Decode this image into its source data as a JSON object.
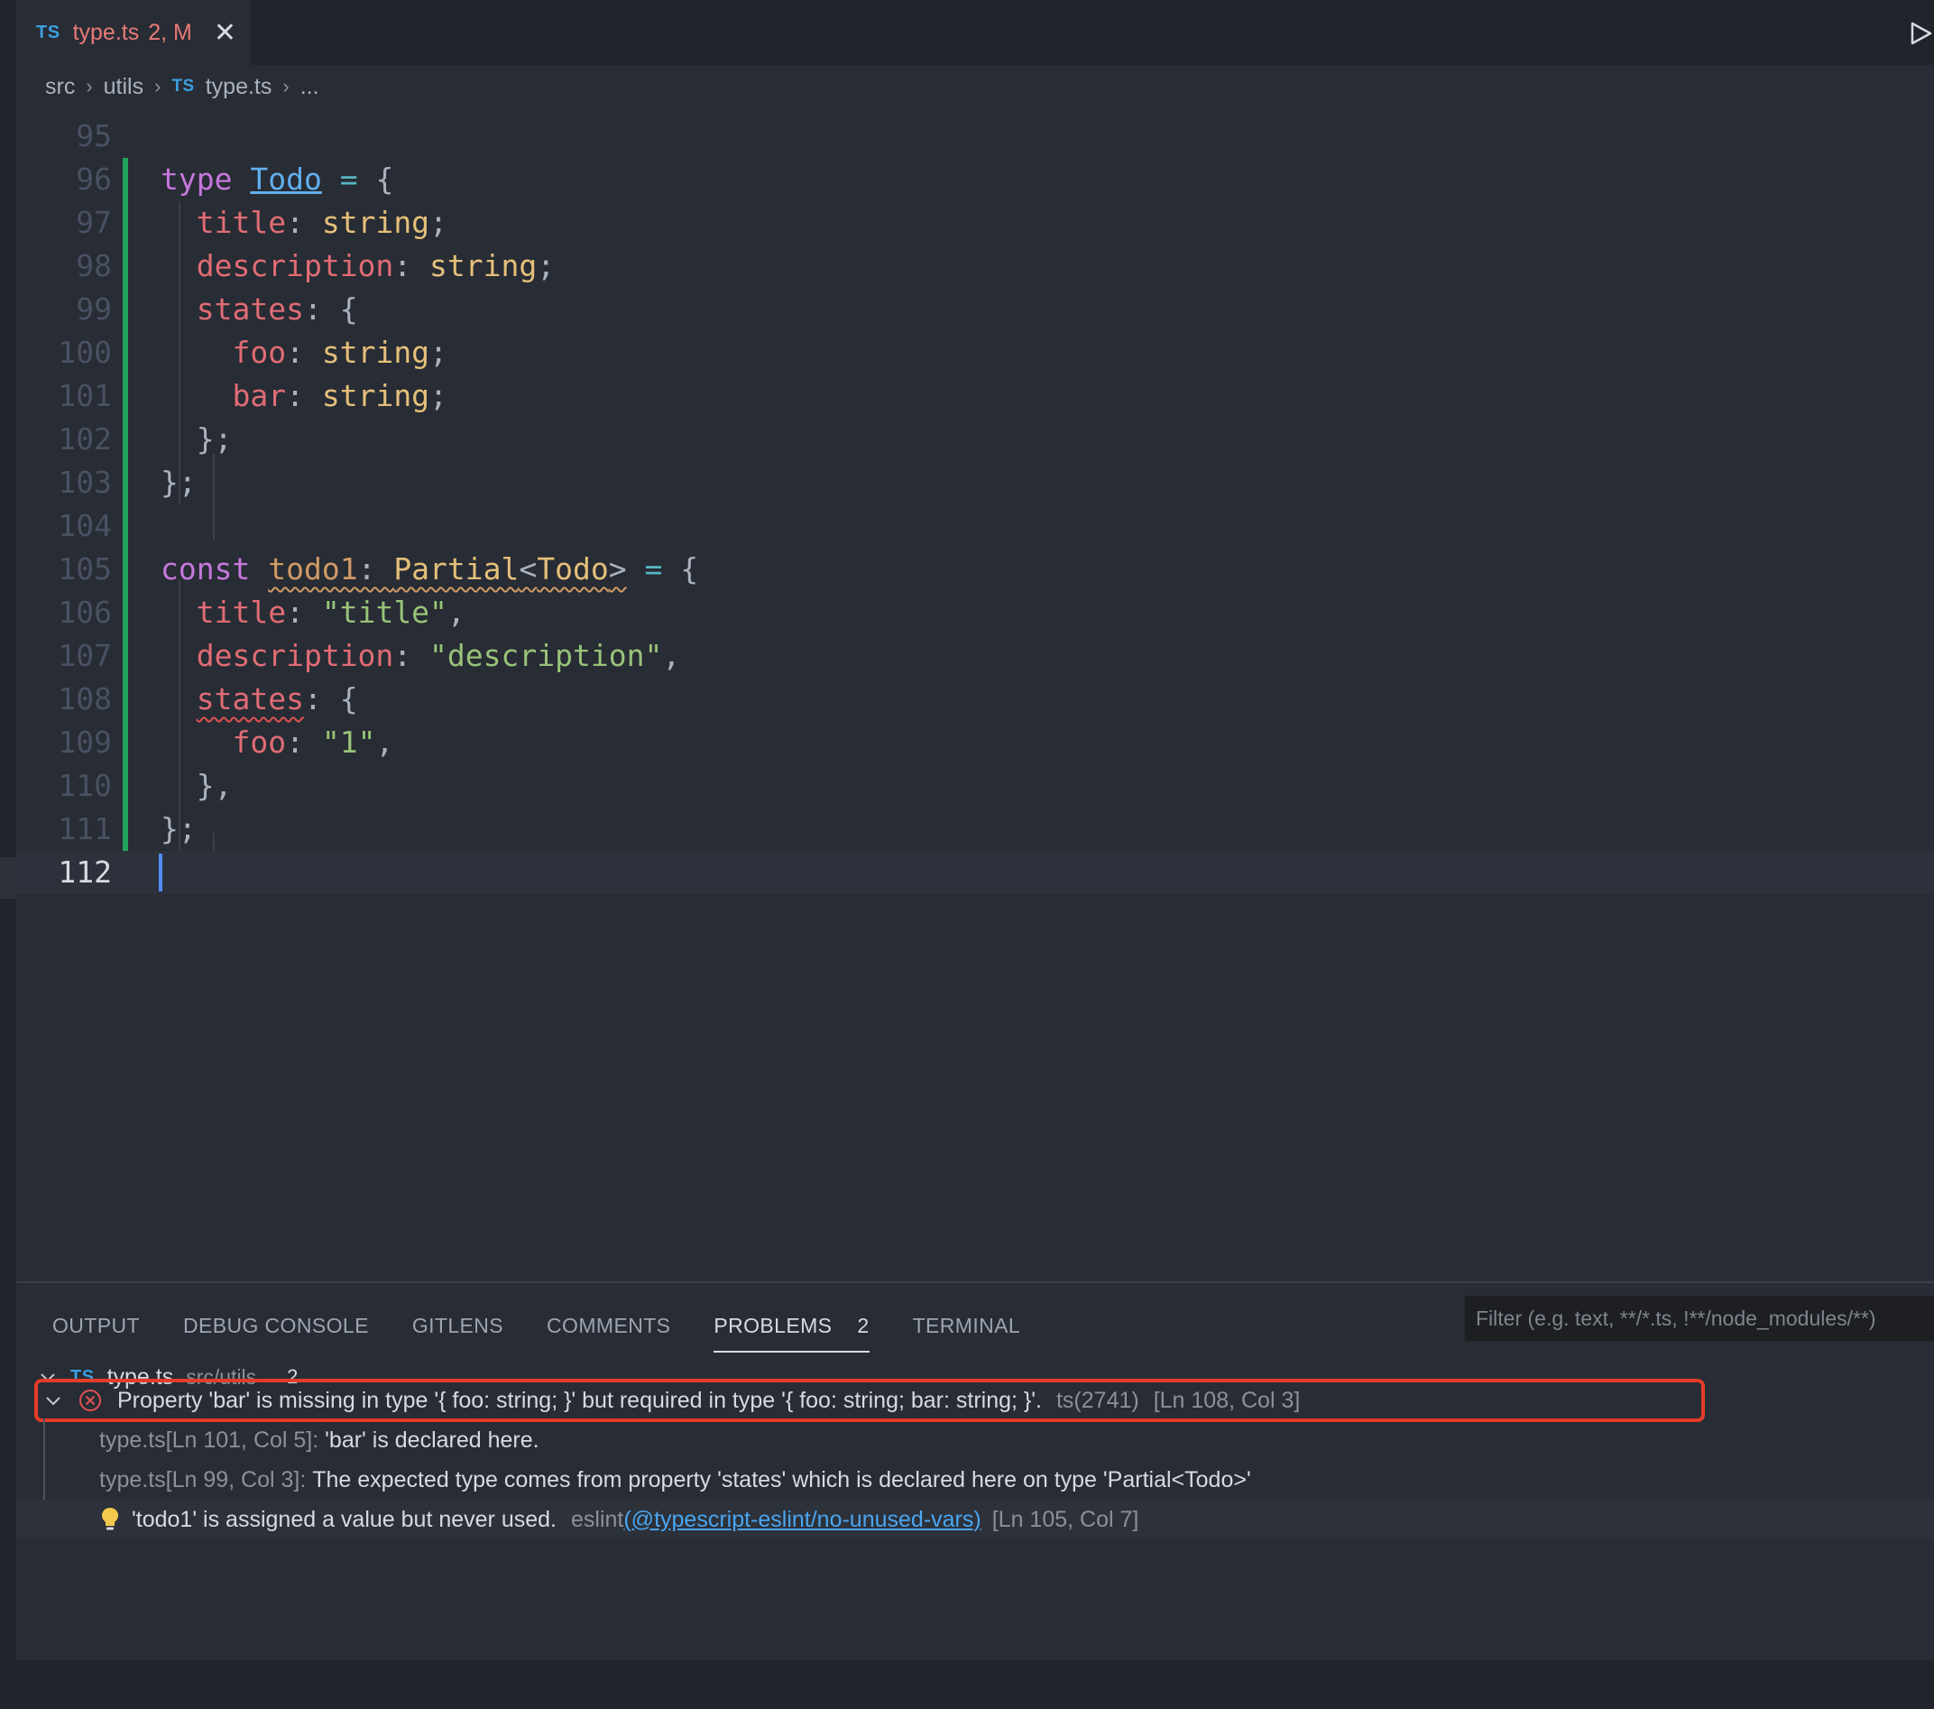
{
  "tab": {
    "badge": "TS",
    "name": "type.ts",
    "status": "2, M"
  },
  "breadcrumb": {
    "items": [
      "src",
      "utils"
    ],
    "badge": "TS",
    "file": "type.ts",
    "more": "..."
  },
  "editor": {
    "line_numbers": [
      "95",
      "96",
      "97",
      "98",
      "99",
      "100",
      "101",
      "102",
      "103",
      "104",
      "105",
      "106",
      "107",
      "108",
      "109",
      "110",
      "111",
      "112"
    ],
    "tokens": {
      "type_kw": "type",
      "todo_name": "Todo",
      "eq_open": " = {",
      "title_prop": "title",
      "description_prop": "description",
      "states_prop": "states",
      "foo_prop": "foo",
      "bar_prop": "bar",
      "string_type": "string",
      "colon": ": ",
      "semi": ";",
      "open_brace": ": {",
      "close_inner": "};",
      "close_outer": "};",
      "const_kw": "const",
      "todo1_var": "todo1",
      "partial_type": "Partial",
      "lt": "<",
      "todo_ref": "Todo",
      "gt": ">",
      "title_str": "\"title\"",
      "description_str": "\"description\"",
      "foo_str": "\"1\"",
      "comma": ",",
      "close_inner_comma": "},"
    }
  },
  "panel": {
    "tabs": [
      {
        "label": "OUTPUT"
      },
      {
        "label": "DEBUG CONSOLE"
      },
      {
        "label": "GITLENS"
      },
      {
        "label": "COMMENTS"
      },
      {
        "label": "PROBLEMS",
        "count": "2"
      },
      {
        "label": "TERMINAL"
      }
    ],
    "filter_placeholder": "Filter (e.g. text, **/*.ts, !**/node_modules/**)",
    "group": {
      "badge": "TS",
      "file": "type.ts",
      "path": "src/utils",
      "count": "2"
    },
    "error": {
      "message": "Property 'bar' is missing in type '{ foo: string; }' but required in type '{ foo: string; bar: string; }'.",
      "code": "ts(2741)",
      "location": "[Ln 108, Col 3]"
    },
    "related": [
      {
        "loc": "type.ts[Ln 101, Col 5]:",
        "text": "'bar' is declared here."
      },
      {
        "loc": "type.ts[Ln 99, Col 3]:",
        "text": "The expected type comes from property 'states' which is declared here on type 'Partial<Todo>'"
      }
    ],
    "warning": {
      "message": "'todo1' is assigned a value but never used.",
      "source": "eslint",
      "rule": "(@typescript-eslint/no-unused-vars)",
      "location": "[Ln 105, Col 7]"
    }
  },
  "colors": {
    "error_highlight": "#e33d2a",
    "git_added": "#1fa359",
    "ts_badge": "#3c9fe0"
  }
}
